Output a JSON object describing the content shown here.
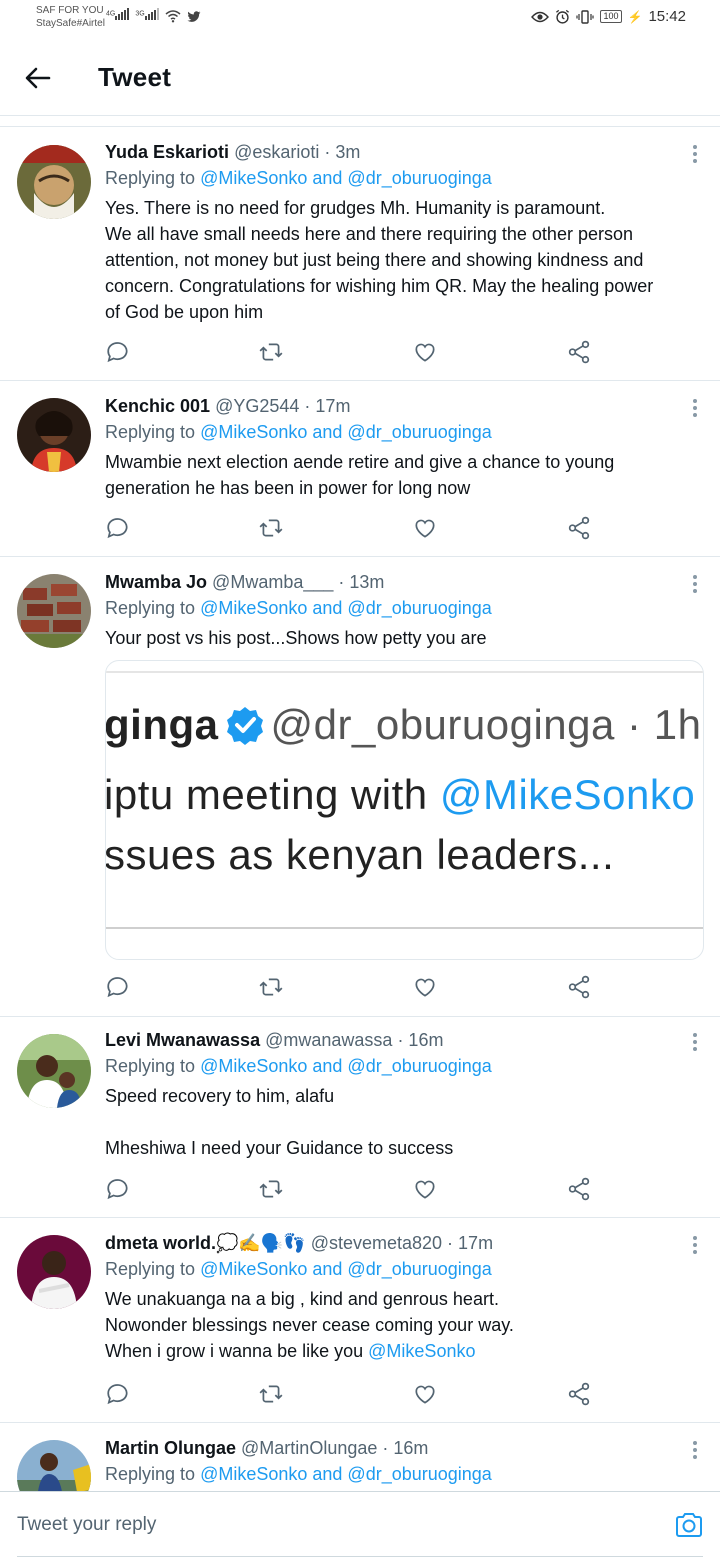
{
  "status_bar": {
    "carrier_line1": "SAF FOR YOU",
    "carrier_line2": "StaySafe#Airtel",
    "net1": "4G",
    "net2": "3G",
    "battery": "100",
    "time": "15:42"
  },
  "header": {
    "title": "Tweet"
  },
  "tweets": [
    {
      "name": "Yuda Eskarioti",
      "handle": "@eskarioti",
      "time": "· 3m",
      "replying_prefix": "Replying to",
      "replying_targets": "@MikeSonko and @dr_oburuoginga",
      "lines": [
        "Yes. There is no need for grudges Mh. Humanity is paramount.",
        "We all have small needs here and there requiring the other person",
        "attention, not money but just being there and showing kindness and",
        "concern. Congratulations for wishing him QR. May the healing power",
        "of God be upon him"
      ]
    },
    {
      "name": "Kenchic 001",
      "handle": "@YG2544",
      "time": "· 17m",
      "replying_prefix": "Replying to",
      "replying_targets": "@MikeSonko and @dr_oburuoginga",
      "lines": [
        "Mwambie next election aende retire and give a chance to young",
        "generation he has been in power for long now"
      ]
    },
    {
      "name": "Mwamba Jo",
      "handle": "@Mwamba___",
      "time": "· 13m",
      "replying_prefix": "Replying to",
      "replying_targets": "@MikeSonko and @dr_oburuoginga",
      "lines": [
        "Your post vs his post...Shows how petty you are"
      ],
      "embed": {
        "name": "ginga",
        "handle": "@dr_oburuoginga · 1h",
        "line2_text": "iptu meeting with",
        "line2_link": "@MikeSonko",
        "line3": "ssues as kenyan leaders..."
      }
    },
    {
      "name": "Levi Mwanawassa",
      "handle": "@mwanawassa",
      "time": "· 16m",
      "replying_prefix": "Replying to",
      "replying_targets": "@MikeSonko and @dr_oburuoginga",
      "lines": [
        "Speed recovery to him, alafu",
        "",
        "Mheshiwa I need your Guidance to success"
      ]
    },
    {
      "name": "dmeta world.💭✍️🗣️👣",
      "handle": "@stevemeta820",
      "time": "· 17m",
      "replying_prefix": "Replying to",
      "replying_targets": "@MikeSonko and @dr_oburuoginga",
      "lines": [
        "We unakuanga na a big , kind and genrous heart.",
        "Nowonder  blessings never cease coming your way.",
        "When i grow i wanna be like you"
      ],
      "mention": "@MikeSonko"
    },
    {
      "name": "Martin Olungae",
      "handle": "@MartinOlungae",
      "time": "· 16m",
      "replying_prefix": "Replying to",
      "replying_targets": "@MikeSonko and @dr_oburuoginga"
    }
  ],
  "composer": {
    "placeholder": "Tweet your reply"
  },
  "colors": {
    "accent": "#1d9bf0",
    "secondary_text": "#536471",
    "divider": "#e1e8ed"
  }
}
